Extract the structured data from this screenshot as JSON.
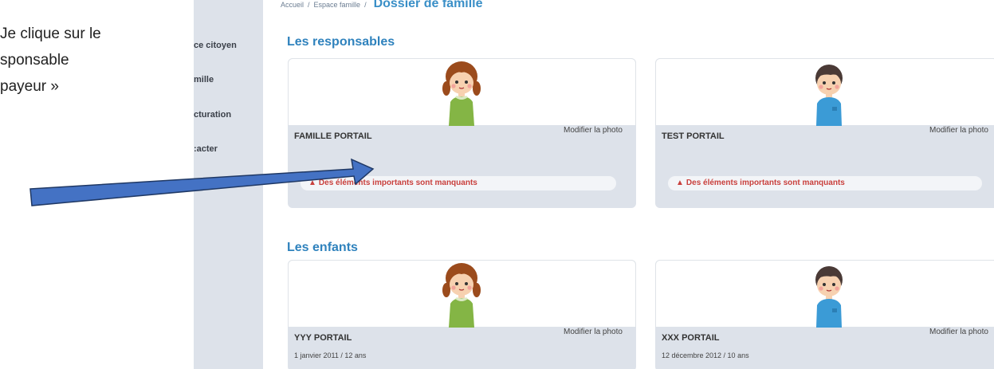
{
  "annotation": {
    "lines": [
      "Je clique sur le",
      "sponsable",
      "payeur »"
    ]
  },
  "sidebar": {
    "items": [
      {
        "label": "ce citoyen"
      },
      {
        "label": "mille"
      },
      {
        "label": "cturation"
      },
      {
        "label": ":acter"
      }
    ]
  },
  "breadcrumb": {
    "items": [
      "Accueil",
      "Espace famille"
    ],
    "current": "Dossier de famille"
  },
  "sections": {
    "responsables_title": "Les responsables",
    "enfants_title": "Les enfants"
  },
  "responsables": [
    {
      "name": "FAMILLE PORTAIL",
      "modify_label": "Modifier la photo",
      "alert": "Des éléments importants sont manquants",
      "avatar": "girl-avatar-icon"
    },
    {
      "name": "TEST PORTAIL",
      "modify_label": "Modifier la photo",
      "alert": "Des éléments importants sont manquants",
      "avatar": "boy-avatar-icon"
    }
  ],
  "enfants": [
    {
      "name": "YYY PORTAIL",
      "modify_label": "Modifier la photo",
      "info": "1 janvier 2011 / 12 ans",
      "avatar": "girl-avatar-icon"
    },
    {
      "name": "XXX PORTAIL",
      "modify_label": "Modifier la photo",
      "info": "12 décembre 2012 / 10 ans",
      "avatar": "boy-avatar-icon"
    }
  ],
  "colors": {
    "accent": "#2f82bd",
    "sidebar": "#dde2ea",
    "alert": "#c9403d",
    "arrow_fill": "#4472c4",
    "arrow_stroke": "#1f3864"
  }
}
